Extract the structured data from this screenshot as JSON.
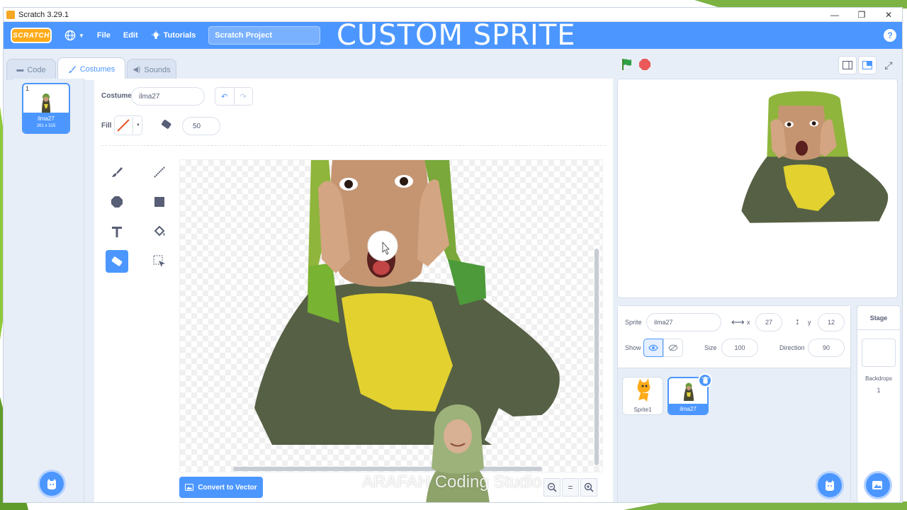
{
  "window": {
    "title": "Scratch 3.29.1",
    "controls": [
      "—",
      "❐",
      "✕"
    ]
  },
  "menubar": {
    "logo": "SCRATCH",
    "file": "File",
    "edit": "Edit",
    "tutorials": "Tutorials",
    "project_title": "Scratch Project",
    "overlay_title": "CUSTOM SPRITE",
    "help": "?"
  },
  "tabs": [
    {
      "label": "Code",
      "icon": "code-icon"
    },
    {
      "label": "Costumes",
      "icon": "brush-icon"
    },
    {
      "label": "Sounds",
      "icon": "speaker-icon"
    }
  ],
  "costumes": [
    {
      "number": "1",
      "name": "ilma27",
      "size": "261 x 315"
    }
  ],
  "editor": {
    "costume_label": "Costume",
    "costume_name": "ilma27",
    "fill_label": "Fill",
    "brush_size": "50",
    "convert_button": "Convert to Vector",
    "active_tool": "eraser",
    "zoom_out": "−",
    "zoom_reset": "=",
    "zoom_in": "+"
  },
  "watermark": "ARAFAH Coding Studio",
  "sprite_info": {
    "sprite_label": "Sprite",
    "sprite_name": "ilma27",
    "x_label": "x",
    "x": "27",
    "y_label": "y",
    "y": "12",
    "show_label": "Show",
    "size_label": "Size",
    "size": "100",
    "direction_label": "Direction",
    "direction": "90"
  },
  "sprites": [
    {
      "name": "Sprite1",
      "selected": false
    },
    {
      "name": "ilma27",
      "selected": true
    }
  ],
  "stage_pane": {
    "label": "Stage",
    "backdrops_label": "Backdrops",
    "backdrops_count": "1"
  },
  "colors": {
    "accent": "#4c97ff",
    "menubar": "#4c97ff",
    "panel": "#e8eef7",
    "green_flag": "#2ea043",
    "stop": "#ec5959"
  }
}
